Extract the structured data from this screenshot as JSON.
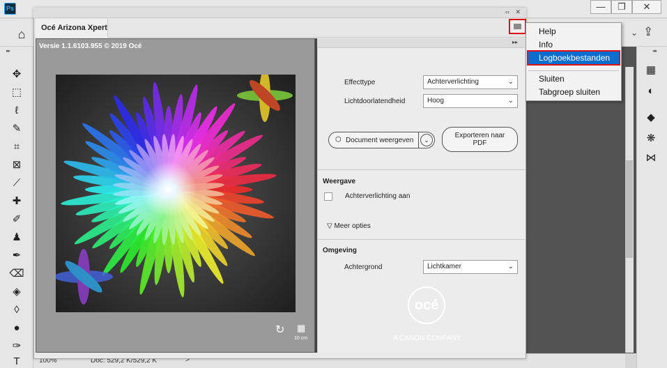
{
  "photoshop": {
    "logo": "Ps",
    "window_buttons": [
      "—",
      "❐",
      "✕"
    ],
    "status_zoom": "100%",
    "status_doc": "Doc: 529,2 K/529,2 K",
    "status_arrow": ">"
  },
  "plugin": {
    "title": "Océ Arizona Xpert",
    "collapse_label": "‹‹",
    "close_label": "✕",
    "version": "Versie 1.1.6103.955 © 2019 Océ",
    "scale_label": "10 cm",
    "effect_label": "Effecttype",
    "effect_value": "Achterverlichting",
    "transmittance_label": "Lichtdoorlatendheid",
    "transmittance_value": "Hoog",
    "view_document_label": "Document weergeven",
    "export_pdf_label_line1": "Exporteren naar",
    "export_pdf_label_line2": "PDF",
    "display_section": "Weergave",
    "backlight_on_label": "Achterverlichting aan",
    "more_options_label": "▽ Meer opties",
    "environment_section": "Omgeving",
    "background_label": "Achtergrond",
    "background_value": "Lichtkamer",
    "oce_logo_text": "océ",
    "canon_text": "A CANON COMPANY"
  },
  "menu": {
    "items": [
      "Help",
      "Info",
      "Logboekbestanden",
      "Sluiten",
      "Tabgroep sluiten"
    ],
    "highlighted": "Logboekbestanden"
  },
  "colors": {
    "highlight": "#0b6ecf",
    "annotation_red": "#e01010"
  }
}
